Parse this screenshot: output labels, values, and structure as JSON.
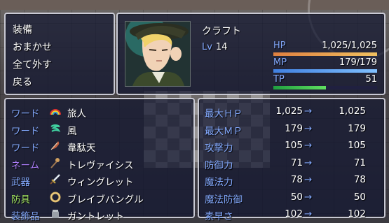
{
  "commands": [
    "装備",
    "おまかせ",
    "全て外す",
    "戻る"
  ],
  "actor": {
    "name": "クラフト",
    "level_label": "Lv",
    "level": "14",
    "hp": {
      "label": "HP",
      "value": "1,025/1,025",
      "ratio": 1.0
    },
    "mp": {
      "label": "MP",
      "value": "179/179",
      "ratio": 1.0
    },
    "tp": {
      "label": "TP",
      "value": "51",
      "ratio": 0.51
    }
  },
  "slots": [
    {
      "type": "ワード",
      "icon": "rainbow-icon",
      "item": "旅人",
      "type_color": "#84aaff"
    },
    {
      "type": "ワード",
      "icon": "wind-icon",
      "item": "風",
      "type_color": "#84aaff"
    },
    {
      "type": "ワード",
      "icon": "feather-icon",
      "item": "韋駄天",
      "type_color": "#84aaff"
    },
    {
      "type": "ネーム",
      "icon": "staff-icon",
      "item": "トレヴァイシス",
      "type_color": "#b080ff"
    },
    {
      "type": "武器",
      "icon": "sword-icon",
      "item": "ウィングレット",
      "type_color": "#84aaff"
    },
    {
      "type": "防具",
      "icon": "bangle-icon",
      "item": "ブレイブバングル",
      "type_color": "#a0e060"
    },
    {
      "type": "装飾品",
      "icon": "gauntlet-icon",
      "item": "ガントレット",
      "type_color": "#84aaff"
    }
  ],
  "params": [
    {
      "name": "最大ＨＰ",
      "current": "1,025",
      "arrow": "→",
      "new": "1,025"
    },
    {
      "name": "最大ＭＰ",
      "current": "179",
      "arrow": "→",
      "new": "179"
    },
    {
      "name": "攻撃力",
      "current": "105",
      "arrow": "→",
      "new": "105"
    },
    {
      "name": "防御力",
      "current": "71",
      "arrow": "→",
      "new": "71"
    },
    {
      "name": "魔法力",
      "current": "78",
      "arrow": "→",
      "new": "78"
    },
    {
      "name": "魔法防御",
      "current": "50",
      "arrow": "→",
      "new": "50"
    },
    {
      "name": "素早さ",
      "current": "102",
      "arrow": "→",
      "new": "102"
    }
  ],
  "colors": {
    "system_blue": "#84aaff",
    "hp_gauge": [
      "#e08040",
      "#f0c060"
    ],
    "mp_gauge": [
      "#4080e0",
      "#80c0ff"
    ],
    "tp_gauge": [
      "#20a040",
      "#60e060"
    ]
  }
}
